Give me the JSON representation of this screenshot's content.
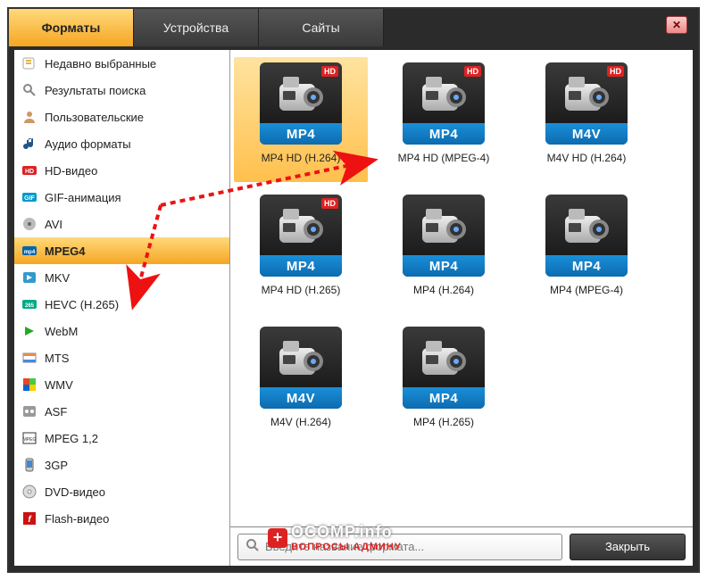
{
  "tabs": {
    "formats": "Форматы",
    "devices": "Устройства",
    "sites": "Сайты"
  },
  "sidebar": {
    "items": [
      {
        "label": "Недавно выбранные",
        "icon": "recent"
      },
      {
        "label": "Результаты поиска",
        "icon": "search"
      },
      {
        "label": "Пользовательские",
        "icon": "user"
      },
      {
        "label": "Аудио форматы",
        "icon": "audio"
      },
      {
        "label": "HD-видео",
        "icon": "hd"
      },
      {
        "label": "GIF-анимация",
        "icon": "gif"
      },
      {
        "label": "AVI",
        "icon": "avi"
      },
      {
        "label": "MPEG4",
        "icon": "mp4",
        "selected": true
      },
      {
        "label": "MKV",
        "icon": "mkv"
      },
      {
        "label": "HEVC (H.265)",
        "icon": "265"
      },
      {
        "label": "WebM",
        "icon": "webm"
      },
      {
        "label": "MTS",
        "icon": "mts"
      },
      {
        "label": "WMV",
        "icon": "wmv"
      },
      {
        "label": "ASF",
        "icon": "asf"
      },
      {
        "label": "MPEG 1,2",
        "icon": "mpeg"
      },
      {
        "label": "3GP",
        "icon": "3gp"
      },
      {
        "label": "DVD-видео",
        "icon": "dvd"
      },
      {
        "label": "Flash-видео",
        "icon": "flash"
      }
    ]
  },
  "formats": [
    {
      "code": "MP4",
      "label": "MP4 HD (H.264)",
      "hd": true,
      "selected": true
    },
    {
      "code": "MP4",
      "label": "MP4 HD (MPEG-4)",
      "hd": true
    },
    {
      "code": "M4V",
      "label": "M4V HD (H.264)",
      "hd": true
    },
    {
      "code": "MP4",
      "label": "MP4 HD (H.265)",
      "hd": true
    },
    {
      "code": "MP4",
      "label": "MP4 (H.264)",
      "hd": false
    },
    {
      "code": "MP4",
      "label": "MP4 (MPEG-4)",
      "hd": false
    },
    {
      "code": "M4V",
      "label": "M4V (H.264)",
      "hd": false
    },
    {
      "code": "MP4",
      "label": "MP4 (H.265)",
      "hd": false
    }
  ],
  "search": {
    "placeholder": "Введите название формата..."
  },
  "buttons": {
    "close": "Закрыть"
  },
  "badges": {
    "hd": "HD"
  },
  "watermark": {
    "line1": "OCOMP.info",
    "line2": "ВОПРОСЫ АДМИНУ"
  },
  "close_x": "✕"
}
